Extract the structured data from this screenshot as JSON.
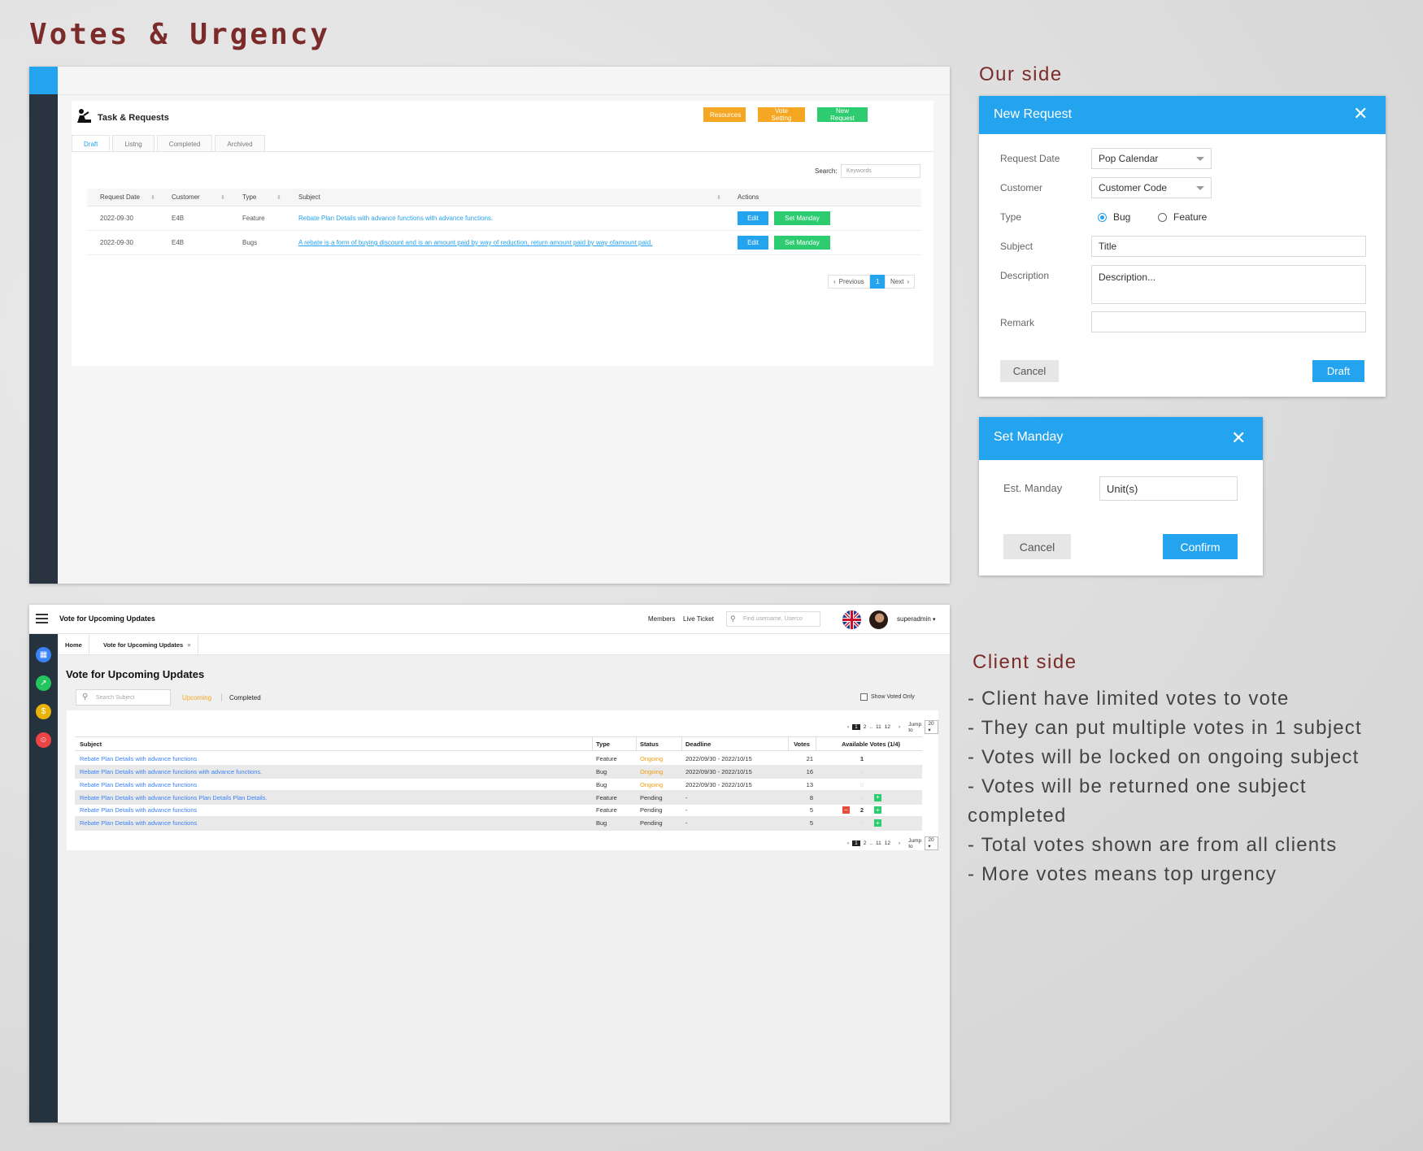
{
  "page_title": "Votes & Urgency",
  "panel1": {
    "title": "Task & Requests",
    "buttons": {
      "resources": "Resources",
      "vote_setting": "Vote Setting",
      "new_request": "New Request"
    },
    "tabs": [
      "Draft",
      "Listng",
      "Completed",
      "Archived"
    ],
    "search_label": "Search:",
    "search_placeholder": "Keywords",
    "columns": [
      "Request Date",
      "Customer",
      "Type",
      "Subject",
      "Actions"
    ],
    "rows": [
      {
        "date": "2022-09-30",
        "customer": "E4B",
        "type": "Feature",
        "subject": "Rebate Plan Details with advance functions with advance functions.",
        "edit": "Edit",
        "manday": "Set Manday"
      },
      {
        "date": "2022-09-30",
        "customer": "E4B",
        "type": "Bugs",
        "subject": "A rebate is a form of buying discount and is an amount paid by way of reduction, return amount paid by way ofamount paid.",
        "edit": "Edit",
        "manday": "Set Manday"
      }
    ],
    "pager": {
      "previous": "Previous",
      "current": "1",
      "next": "Next"
    }
  },
  "our_side": {
    "heading": "Our side",
    "new_request": {
      "title": "New Request",
      "labels": {
        "date": "Request Date",
        "customer": "Customer",
        "type": "Type",
        "subject": "Subject",
        "description": "Description",
        "remark": "Remark"
      },
      "date_value": "Pop Calendar",
      "customer_value": "Customer Code",
      "type_options": [
        "Bug",
        "Feature"
      ],
      "type_selected": "Bug",
      "subject_placeholder": "Title",
      "description_placeholder": "Description...",
      "remark_value": "",
      "cancel": "Cancel",
      "draft": "Draft"
    },
    "set_manday": {
      "title": "Set Manday",
      "label": "Est. Manday",
      "placeholder": "Unit(s)",
      "cancel": "Cancel",
      "confirm": "Confirm"
    }
  },
  "panel2": {
    "app_title": "Vote for Upcoming Updates",
    "nav": {
      "members": "Members",
      "live_ticket": "Live Ticket"
    },
    "find_placeholder": "Find username, Userco",
    "user": "superadmin",
    "breadcrumbs": [
      "Home",
      "Vote for Upcoming Updates"
    ],
    "heading": "Vote for Upcoming Updates",
    "search_placeholder": "Search Subject",
    "tabs": {
      "upcoming": "Upcoming",
      "completed": "Completed"
    },
    "show_voted_only": "Show Voted Only",
    "pagination": {
      "current": "1",
      "pages": [
        "2",
        "..",
        "11",
        "12"
      ],
      "jump": "Jump to",
      "per_page": "20"
    },
    "columns": [
      "Subject",
      "Type",
      "Status",
      "Deadline",
      "Votes",
      "Available Votes (1/4)"
    ],
    "rows": [
      {
        "subject": "Rebate Plan Details with advance functions",
        "type": "Feature",
        "status": "Ongoing",
        "deadline": "2022/09/30 - 2022/10/15",
        "votes": "21",
        "my_votes": "1",
        "controls": false
      },
      {
        "subject": "Rebate Plan Details with advance functions with advance functions.",
        "type": "Bug",
        "status": "Ongoing",
        "deadline": "2022/09/30 - 2022/10/15",
        "votes": "16",
        "my_votes": "0",
        "controls": false
      },
      {
        "subject": "Rebate Plan Details with advance functions",
        "type": "Bug",
        "status": "Ongoing",
        "deadline": "2022/09/30 - 2022/10/15",
        "votes": "13",
        "my_votes": "0",
        "controls": false
      },
      {
        "subject": "Rebate Plan Details with advance functions  Plan Details Plan Details.",
        "type": "Feature",
        "status": "Pending",
        "deadline": "-",
        "votes": "8",
        "my_votes": "0",
        "controls": "plus"
      },
      {
        "subject": "Rebate Plan Details with advance functions",
        "type": "Feature",
        "status": "Pending",
        "deadline": "-",
        "votes": "5",
        "my_votes": "2",
        "controls": "both"
      },
      {
        "subject": "Rebate Plan Details with advance functions",
        "type": "Bug",
        "status": "Pending",
        "deadline": "-",
        "votes": "5",
        "my_votes": "0",
        "controls": "plus"
      }
    ]
  },
  "client_side": {
    "heading": "Client side",
    "notes": [
      "- Client have limited votes to vote",
      "- They can put multiple votes in 1 subject",
      "- Votes will be locked on ongoing subject",
      "- Votes will be returned one subject completed",
      "- Total votes shown are from all clients",
      "- More votes means top urgency"
    ]
  },
  "colors": {
    "accent": "#24a3ef",
    "green": "#2ecc71",
    "orange": "#f5a623",
    "heading": "#7c2b2b",
    "sidebar": "#2a3440"
  },
  "icons": [
    "worker-icon",
    "sort-icon",
    "hamburger-icon",
    "search-icon",
    "uk-flag-icon",
    "avatar",
    "chevron-down-icon",
    "close-icon",
    "briefcase-icon",
    "chart-icon",
    "coin-icon",
    "user-icon"
  ]
}
